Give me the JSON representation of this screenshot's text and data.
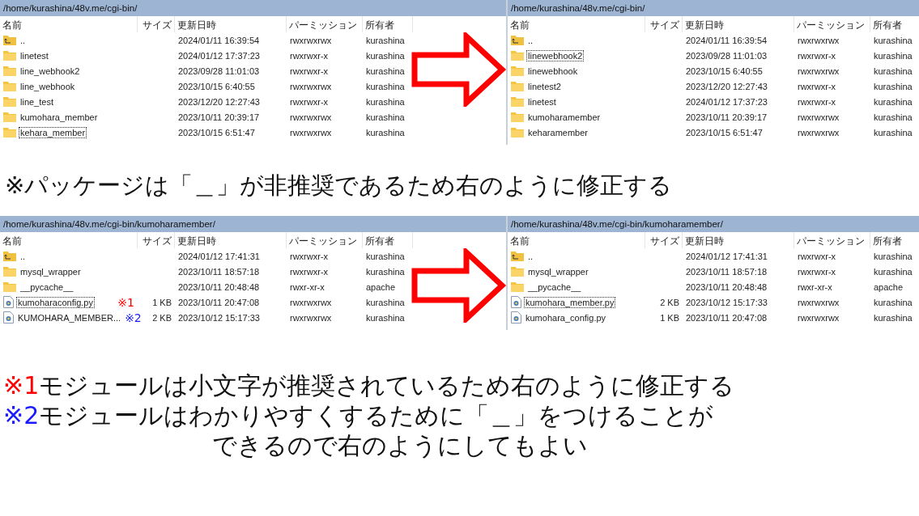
{
  "sections": [
    {
      "panels": [
        {
          "path": "/home/kurashina/48v.me/cgi-bin/",
          "columns": [
            "名前",
            "サイズ",
            "更新日時",
            "パーミッション",
            "所有者"
          ],
          "rows": [
            {
              "kind": "parent",
              "name": "..",
              "size": "",
              "modified": "2024/01/11 16:39:54",
              "permissions": "rwxrwxrwx",
              "owner": "kurashina",
              "focused": false
            },
            {
              "kind": "folder",
              "name": "linetest",
              "size": "",
              "modified": "2024/01/12 17:37:23",
              "permissions": "rwxrwxr-x",
              "owner": "kurashina",
              "focused": false
            },
            {
              "kind": "folder",
              "name": "line_webhook2",
              "size": "",
              "modified": "2023/09/28 11:01:03",
              "permissions": "rwxrwxr-x",
              "owner": "kurashina",
              "focused": false
            },
            {
              "kind": "folder",
              "name": "line_webhook",
              "size": "",
              "modified": "2023/10/15 6:40:55",
              "permissions": "rwxrwxrwx",
              "owner": "kurashina",
              "focused": false
            },
            {
              "kind": "folder",
              "name": "line_test",
              "size": "",
              "modified": "2023/12/20 12:27:43",
              "permissions": "rwxrwxr-x",
              "owner": "kurashina",
              "focused": false
            },
            {
              "kind": "folder",
              "name": "kumohara_member",
              "size": "",
              "modified": "2023/10/11 20:39:17",
              "permissions": "rwxrwxrwx",
              "owner": "kurashina",
              "focused": false
            },
            {
              "kind": "folder",
              "name": "kehara_member",
              "size": "",
              "modified": "2023/10/15 6:51:47",
              "permissions": "rwxrwxrwx",
              "owner": "kurashina",
              "focused": true
            }
          ]
        },
        {
          "path": "/home/kurashina/48v.me/cgi-bin/",
          "columns": [
            "名前",
            "サイズ",
            "更新日時",
            "パーミッション",
            "所有者"
          ],
          "rows": [
            {
              "kind": "parent",
              "name": "..",
              "size": "",
              "modified": "2024/01/11 16:39:54",
              "permissions": "rwxrwxrwx",
              "owner": "kurashina",
              "focused": false
            },
            {
              "kind": "folder",
              "name": "linewebhook2",
              "size": "",
              "modified": "2023/09/28 11:01:03",
              "permissions": "rwxrwxr-x",
              "owner": "kurashina",
              "focused": true
            },
            {
              "kind": "folder",
              "name": "linewebhook",
              "size": "",
              "modified": "2023/10/15 6:40:55",
              "permissions": "rwxrwxrwx",
              "owner": "kurashina",
              "focused": false
            },
            {
              "kind": "folder",
              "name": "linetest2",
              "size": "",
              "modified": "2023/12/20 12:27:43",
              "permissions": "rwxrwxr-x",
              "owner": "kurashina",
              "focused": false
            },
            {
              "kind": "folder",
              "name": "linetest",
              "size": "",
              "modified": "2024/01/12 17:37:23",
              "permissions": "rwxrwxr-x",
              "owner": "kurashina",
              "focused": false
            },
            {
              "kind": "folder",
              "name": "kumoharamember",
              "size": "",
              "modified": "2023/10/11 20:39:17",
              "permissions": "rwxrwxrwx",
              "owner": "kurashina",
              "focused": false
            },
            {
              "kind": "folder",
              "name": "keharamember",
              "size": "",
              "modified": "2023/10/15 6:51:47",
              "permissions": "rwxrwxrwx",
              "owner": "kurashina",
              "focused": false
            }
          ]
        }
      ],
      "notes": [
        {
          "lines": [
            "※パッケージは「＿」が非推奨であるため右のように修正する"
          ]
        }
      ]
    },
    {
      "panels": [
        {
          "path": "/home/kurashina/48v.me/cgi-bin/kumoharamember/",
          "columns": [
            "名前",
            "サイズ",
            "更新日時",
            "パーミッション",
            "所有者"
          ],
          "rows": [
            {
              "kind": "parent",
              "name": "..",
              "size": "",
              "modified": "2024/01/12 17:41:31",
              "permissions": "rwxrwxr-x",
              "owner": "kurashina",
              "focused": false
            },
            {
              "kind": "folder",
              "name": "mysql_wrapper",
              "size": "",
              "modified": "2023/10/11 18:57:18",
              "permissions": "rwxrwxr-x",
              "owner": "kurashina",
              "focused": false
            },
            {
              "kind": "folder",
              "name": "__pycache__",
              "size": "",
              "modified": "2023/10/11 20:48:48",
              "permissions": "rwxr-xr-x",
              "owner": "apache",
              "focused": false
            },
            {
              "kind": "file",
              "name": "kumoharaconfig.py",
              "mark": "※1",
              "color": "#ff0000",
              "size": "1 KB",
              "modified": "2023/10/11 20:47:08",
              "permissions": "rwxrwxrwx",
              "owner": "kurashina",
              "focused": true
            },
            {
              "kind": "file",
              "name": "KUMOHARA_MEMBER...",
              "mark": "※2",
              "color": "#1a1aff",
              "size": "2 KB",
              "modified": "2023/10/12 15:17:33",
              "permissions": "rwxrwxrwx",
              "owner": "kurashina",
              "focused": false
            }
          ]
        },
        {
          "path": "/home/kurashina/48v.me/cgi-bin/kumoharamember/",
          "columns": [
            "名前",
            "サイズ",
            "更新日時",
            "パーミッション",
            "所有者"
          ],
          "rows": [
            {
              "kind": "parent",
              "name": "..",
              "size": "",
              "modified": "2024/01/12 17:41:31",
              "permissions": "rwxrwxr-x",
              "owner": "kurashina",
              "focused": false
            },
            {
              "kind": "folder",
              "name": "mysql_wrapper",
              "size": "",
              "modified": "2023/10/11 18:57:18",
              "permissions": "rwxrwxr-x",
              "owner": "kurashina",
              "focused": false
            },
            {
              "kind": "folder",
              "name": "__pycache__",
              "size": "",
              "modified": "2023/10/11 20:48:48",
              "permissions": "rwxr-xr-x",
              "owner": "apache",
              "focused": false
            },
            {
              "kind": "file",
              "name": "kumohara_member.py",
              "size": "2 KB",
              "modified": "2023/10/12 15:17:33",
              "permissions": "rwxrwxrwx",
              "owner": "kurashina",
              "focused": true
            },
            {
              "kind": "file",
              "name": "kumohara_config.py",
              "size": "1 KB",
              "modified": "2023/10/11 20:47:08",
              "permissions": "rwxrwxrwx",
              "owner": "kurashina",
              "focused": false
            }
          ]
        }
      ],
      "notes": [
        {
          "marker": "※1",
          "color": "#ff0000",
          "lines": [
            "モジュールは小文字が推奨されているため右のように修正する"
          ]
        },
        {
          "marker": "※2",
          "color": "#1a1aff",
          "lines": [
            "モジュールはわかりやすくするために「＿」をつけることが",
            "できるので右のようにしてもよい"
          ]
        }
      ]
    }
  ]
}
